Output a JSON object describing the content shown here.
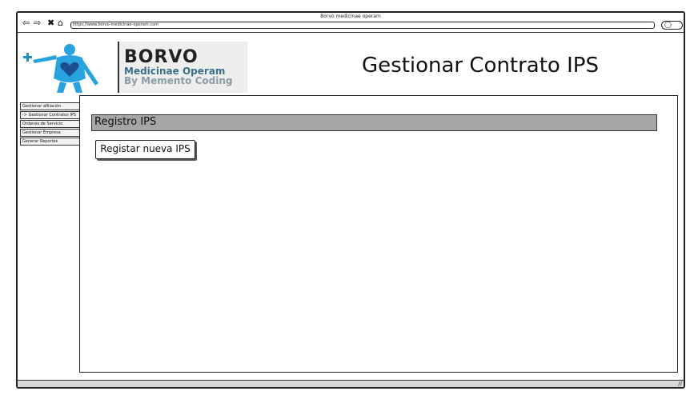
{
  "window": {
    "title": "Borvo medicinae operam",
    "url": "https://www.borvo-medicinae-operam.com"
  },
  "browser": {
    "back_glyph": "⇦",
    "forward_glyph": "⇨",
    "stop_glyph": "✖",
    "home_glyph": "⌂",
    "search_glyph": "◯",
    "resize_glyph": "//"
  },
  "logo": {
    "brand": "BORVO",
    "line2": "Medicinae Operam",
    "line3": "By Memento Coding"
  },
  "page": {
    "title": "Gestionar Contrato IPS"
  },
  "sidebar": {
    "items": [
      {
        "label": "Gestionar afiliación"
      },
      {
        "label": "-> Gestionar Contratos IPS"
      },
      {
        "label": "Ordenes de Servicio"
      },
      {
        "label": "Gestionar Empresa"
      },
      {
        "label": "Generar Reportes"
      }
    ]
  },
  "main": {
    "section_title": "Registro IPS",
    "register_button": "Registar nueva IPS"
  },
  "colors": {
    "section_header_bg": "#a6a6a6",
    "logo_blue": "#3b6f8a",
    "logo_gray": "#8a9ca6",
    "figure_blue": "#29a3e0"
  }
}
